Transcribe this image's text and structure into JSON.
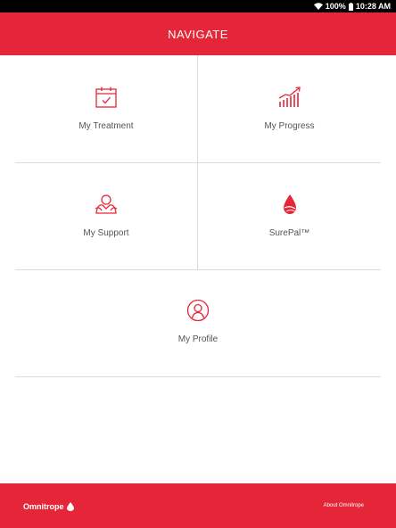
{
  "status": {
    "battery": "100%",
    "time": "10:28 AM"
  },
  "header": {
    "title": "NAVIGATE"
  },
  "tiles": [
    {
      "label": "My Treatment",
      "icon": "calendar-check-icon"
    },
    {
      "label": "My Progress",
      "icon": "growth-chart-icon"
    },
    {
      "label": "My Support",
      "icon": "support-hands-icon"
    },
    {
      "label": "SurePal™",
      "icon": "drop-logo-icon"
    },
    {
      "label": "My Profile",
      "icon": "profile-head-icon"
    }
  ],
  "footer": {
    "brand": "Omnitrope",
    "about": "About Omnitrope"
  },
  "colors": {
    "brand_red": "#e52638",
    "divider": "#dcdcdc",
    "label_gray": "#555555"
  }
}
